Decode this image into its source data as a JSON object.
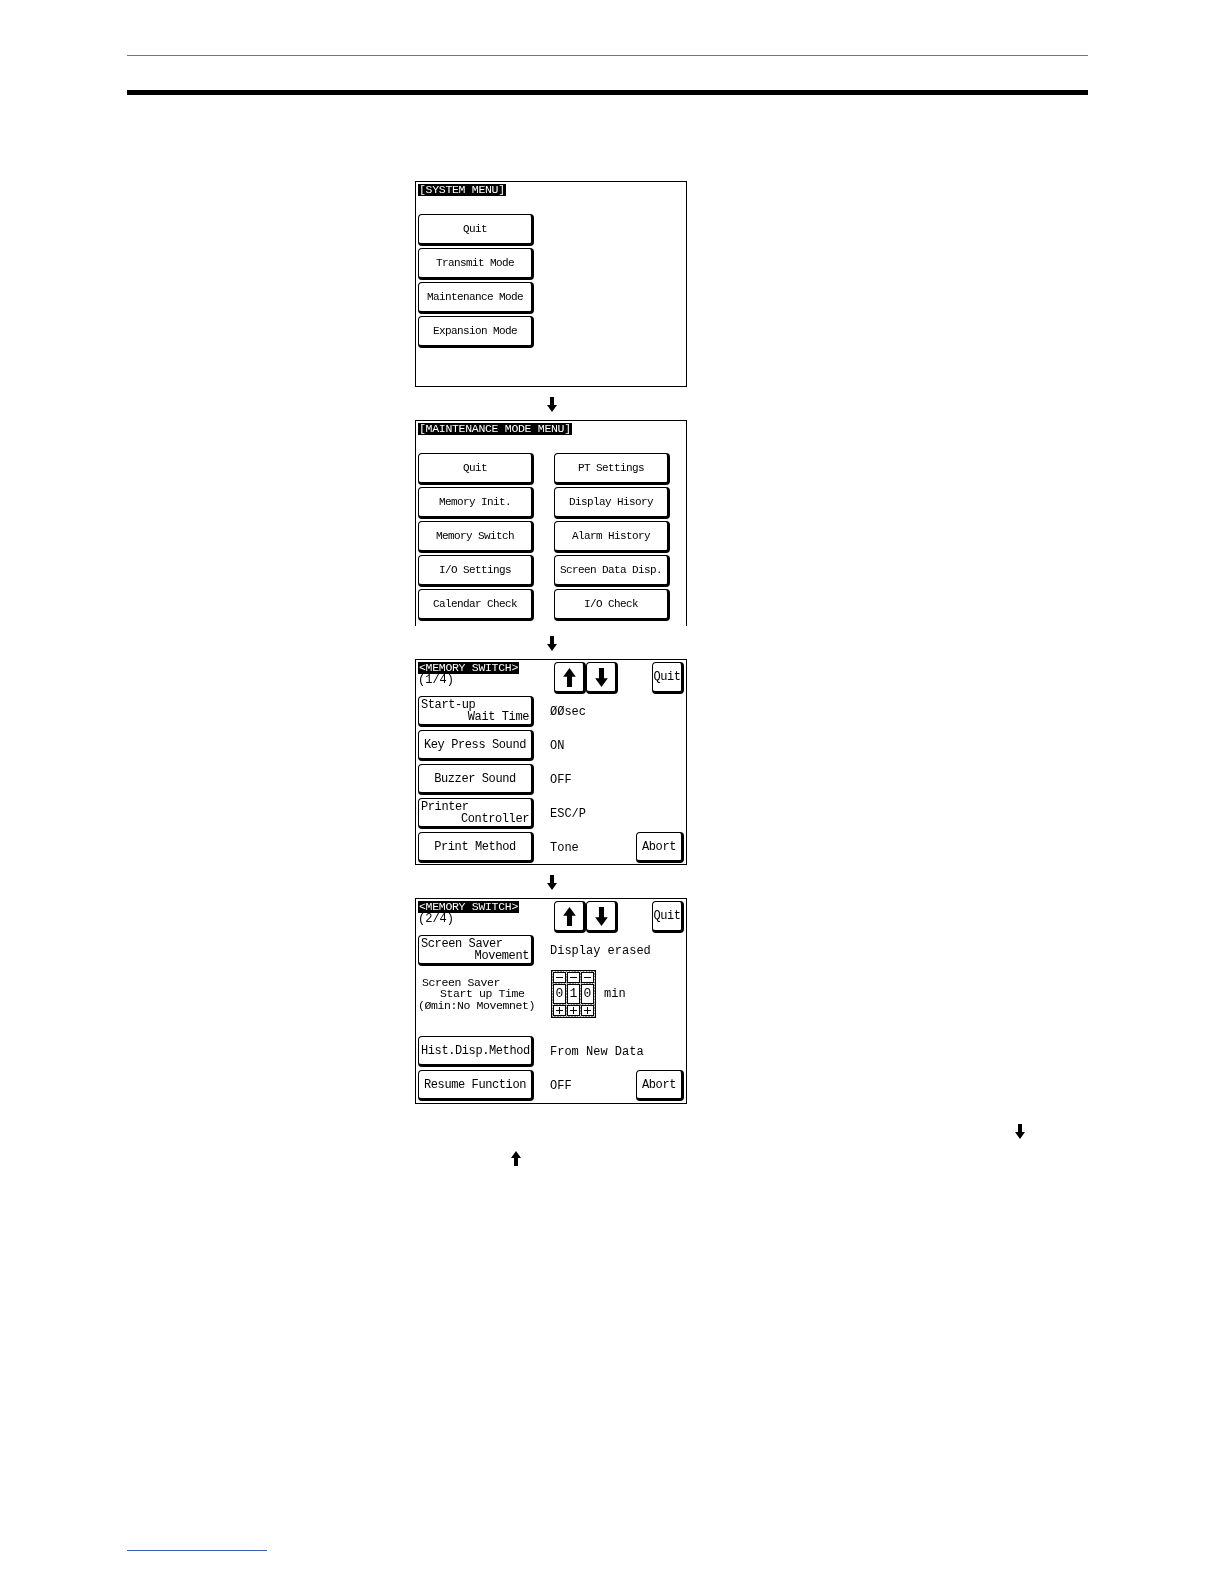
{
  "screens": [
    {
      "kind": "menu",
      "title": "[SYSTEM MENU]",
      "cropped": false,
      "columns": [
        [
          "Quit",
          "Transmit Mode",
          "Maintenance Mode",
          "Expansion Mode"
        ]
      ]
    },
    {
      "kind": "menu",
      "title": "[MAINTENANCE MODE MENU]",
      "cropped": true,
      "columns": [
        [
          "Quit",
          "Memory Init.",
          "Memory Switch",
          "I/O Settings",
          "Calendar Check"
        ],
        [
          "PT Settings",
          "Display Hisory",
          "Alarm History",
          "Screen Data Disp.",
          "I/O Check"
        ]
      ]
    },
    {
      "kind": "settings",
      "title": "<MEMORY SWITCH>",
      "page": "(1/4)",
      "quit": "Quit",
      "abort": "Abort",
      "cropped": false,
      "rows": [
        {
          "kind": "button",
          "lines": [
            "Start-up",
            "Wait Time"
          ],
          "value": "ØØsec"
        },
        {
          "kind": "button",
          "lines": [
            "Key Press Sound"
          ],
          "value": "ON"
        },
        {
          "kind": "button",
          "lines": [
            "Buzzer Sound"
          ],
          "value": "OFF"
        },
        {
          "kind": "button",
          "lines": [
            "Printer",
            "Controller"
          ],
          "value": "ESC/P"
        },
        {
          "kind": "button",
          "lines": [
            "Print Method"
          ],
          "value": "Tone"
        }
      ]
    },
    {
      "kind": "settings",
      "title": "<MEMORY SWITCH>",
      "page": "(2/4)",
      "quit": "Quit",
      "abort": "Abort",
      "cropped": false,
      "rows": [
        {
          "kind": "button",
          "lines": [
            "Screen Saver",
            "Movement"
          ],
          "value": "Display erased"
        },
        {
          "kind": "spinner",
          "lines": [
            "Screen Saver",
            "Start up Time",
            "(Ømin:No Movemnet)"
          ],
          "digits": [
            "0",
            "1",
            "0"
          ],
          "unit": "min"
        },
        {
          "kind": "button",
          "lines": [
            "Hist.Disp.Method"
          ],
          "value": "From New Data"
        },
        {
          "kind": "button",
          "lines": [
            "Resume Function"
          ],
          "value": "OFF"
        }
      ]
    }
  ]
}
